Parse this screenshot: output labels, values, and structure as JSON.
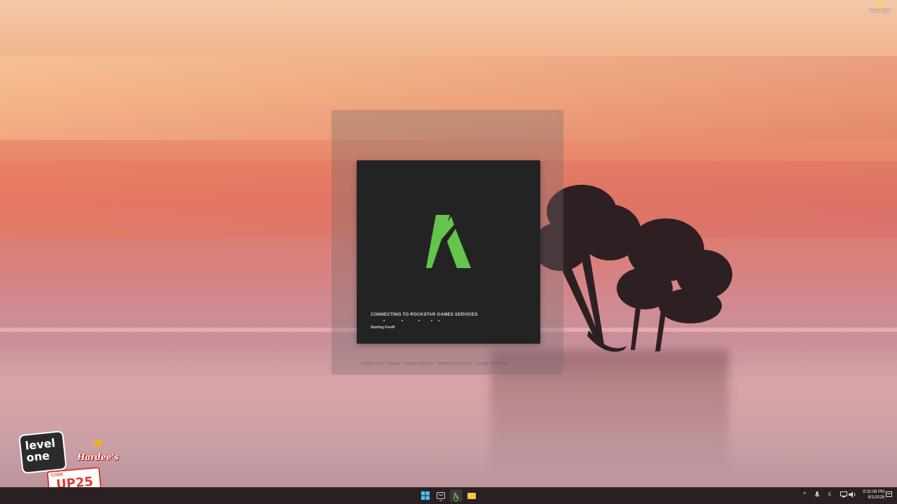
{
  "desktop": {
    "icons": [
      {
        "label": "New folder",
        "icon": "folder-icon"
      }
    ]
  },
  "launcher": {
    "status_text": "CONNECTING TO ROCKSTAR GAMES SERVICES",
    "sub_status": "Starting FiveM",
    "logo": "fivem-logo",
    "accent_color": "#64c44c",
    "footer_links": [
      "CONNECTING TO GAME",
      "PRIVACY POLICY",
      "TERMS OF SERVICE",
      "COOKIE SETTINGS"
    ]
  },
  "ad": {
    "brand_left": "level\none",
    "brand_right": "Hardee's",
    "code_label": "CODE",
    "code_value": "UP25"
  },
  "taskbar": {
    "apps": [
      {
        "name": "start",
        "icon": "windows-icon"
      },
      {
        "name": "xbox",
        "icon": "xbox-icon"
      },
      {
        "name": "fivem",
        "icon": "fivem-icon"
      },
      {
        "name": "file-explorer",
        "icon": "folder-icon"
      }
    ],
    "tray": {
      "chevron": "^",
      "currency": "£",
      "time": "8:32:08 PM",
      "date": "8/1/2026"
    }
  }
}
